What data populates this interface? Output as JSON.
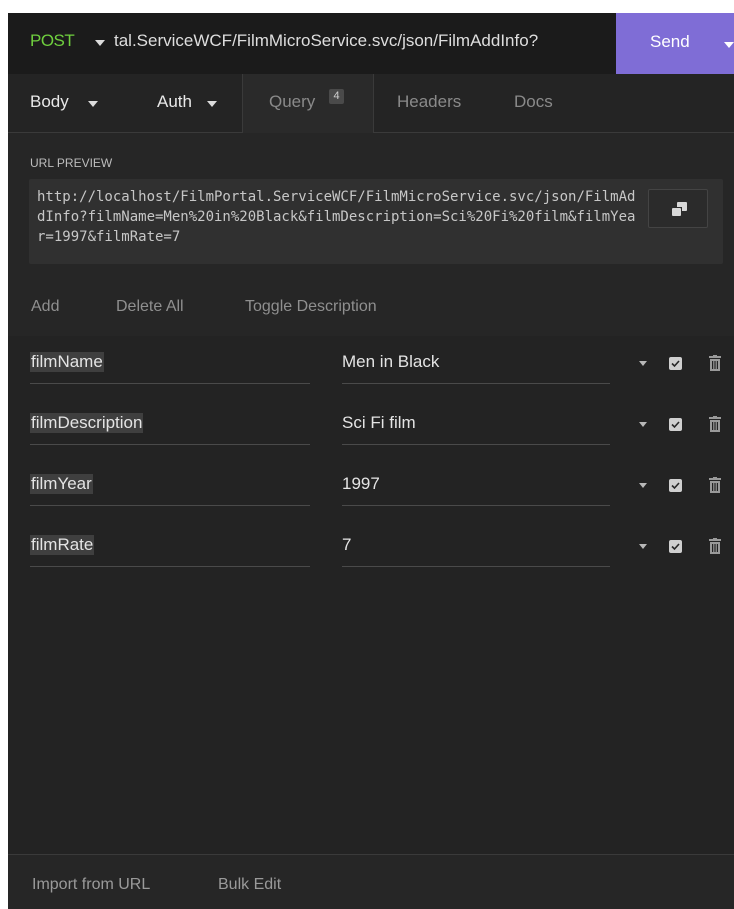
{
  "request": {
    "method": "POST",
    "url": "tal.ServiceWCF/FilmMicroService.svc/json/FilmAddInfo?",
    "send_label": "Send"
  },
  "tabs": [
    {
      "label": "Body"
    },
    {
      "label": "Auth"
    },
    {
      "label": "Query",
      "badge": "4"
    },
    {
      "label": "Headers"
    },
    {
      "label": "Docs"
    }
  ],
  "url_preview": {
    "label": "URL PREVIEW",
    "text": "http://localhost/FilmPortal.ServiceWCF/FilmMicroService.svc/json/FilmAddInfo?filmName=Men%20in%20Black&filmDescription=Sci%20Fi%20film&filmYear=1997&filmRate=7"
  },
  "actions": {
    "add": "Add",
    "delete_all": "Delete All",
    "toggle_description": "Toggle Description"
  },
  "params": [
    {
      "name": "filmName",
      "value": "Men in Black",
      "enabled": true
    },
    {
      "name": "filmDescription",
      "value": "Sci Fi film",
      "enabled": true
    },
    {
      "name": "filmYear",
      "value": "1997",
      "enabled": true
    },
    {
      "name": "filmRate",
      "value": "7",
      "enabled": true
    }
  ],
  "footer": {
    "import_from_url": "Import from URL",
    "bulk_edit": "Bulk Edit"
  },
  "colors": {
    "method": "#6fcf3e",
    "send": "#7f6dd6",
    "background": "#262626"
  },
  "icons": [
    "caret-down-icon",
    "copy-icon",
    "checkbox-icon",
    "trash-icon"
  ]
}
